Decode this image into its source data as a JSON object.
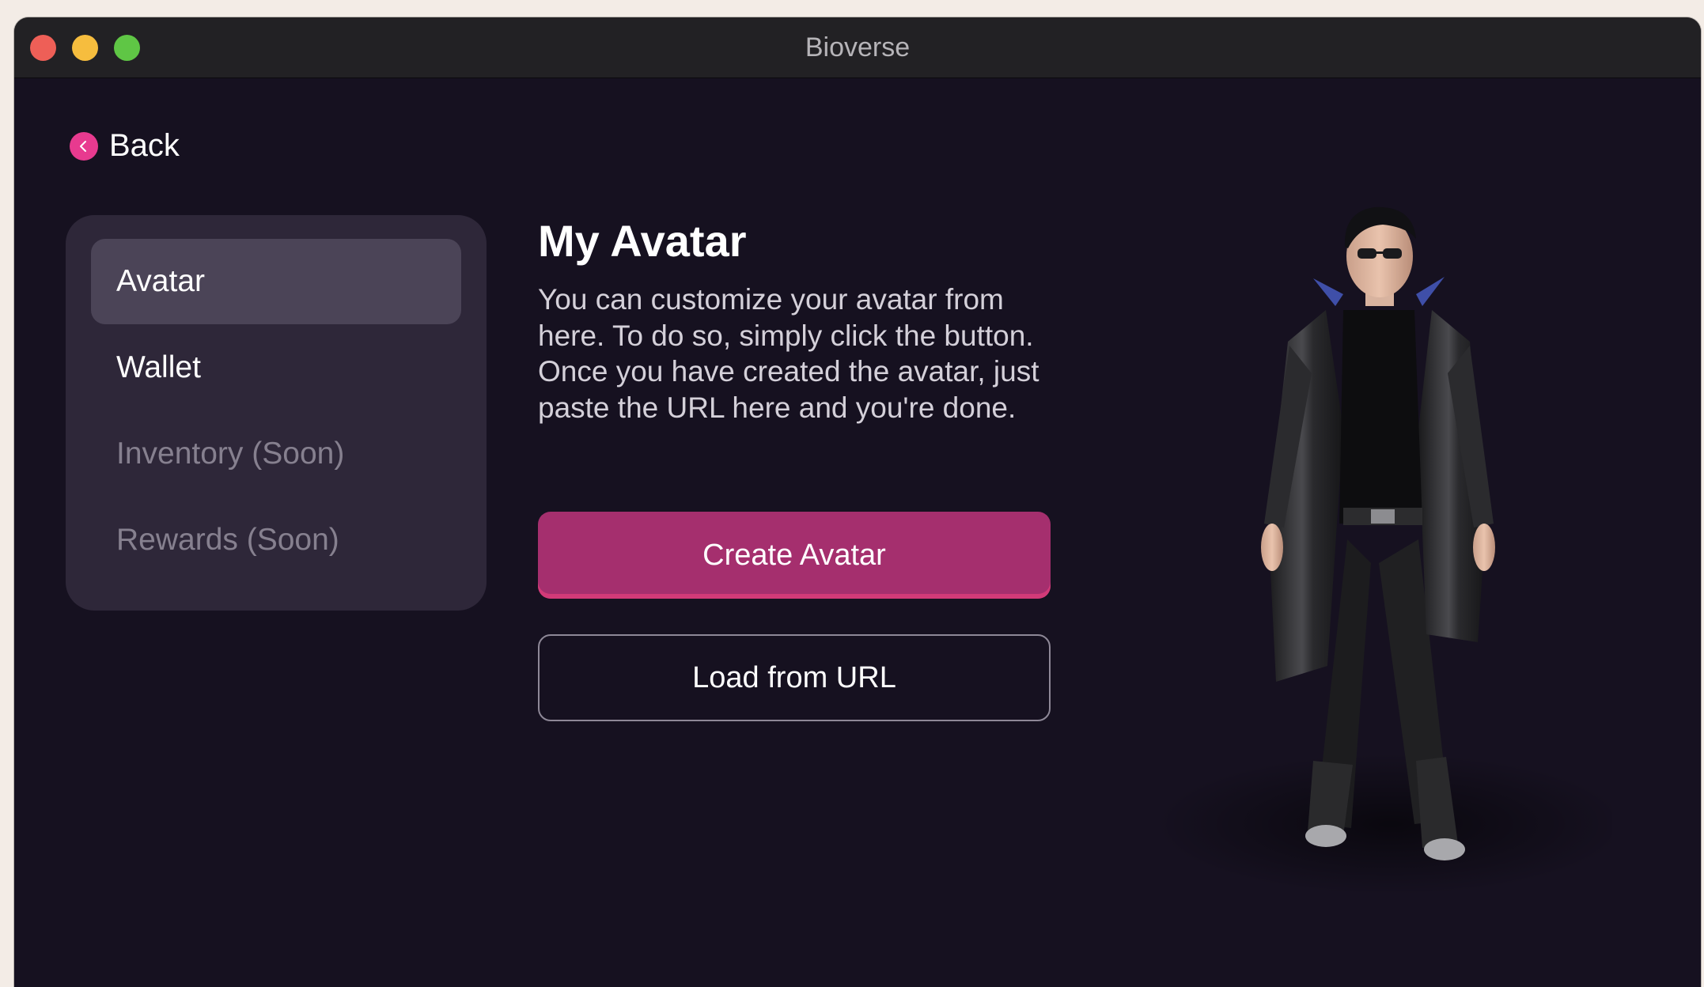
{
  "window": {
    "title": "Bioverse"
  },
  "nav": {
    "back_label": "Back"
  },
  "sidebar": {
    "items": [
      {
        "label": "Avatar",
        "state": "active"
      },
      {
        "label": "Wallet",
        "state": "enabled"
      },
      {
        "label": "Inventory (Soon)",
        "state": "disabled"
      },
      {
        "label": "Rewards (Soon)",
        "state": "disabled"
      }
    ]
  },
  "main": {
    "title": "My Avatar",
    "description": "You can customize your avatar from here. To do so, simply click the button. Once you have created the avatar, just paste the URL here and you're done.",
    "create_button": "Create Avatar",
    "load_button": "Load from URL"
  },
  "icons": {
    "back": "chevron-left-icon"
  },
  "colors": {
    "background": "#161120",
    "sidebar": "#2e2739",
    "sidebar_active": "#4b4457",
    "accent": "#a52f6e",
    "accent_back": "#e83a8f",
    "title_bar": "#222124"
  }
}
